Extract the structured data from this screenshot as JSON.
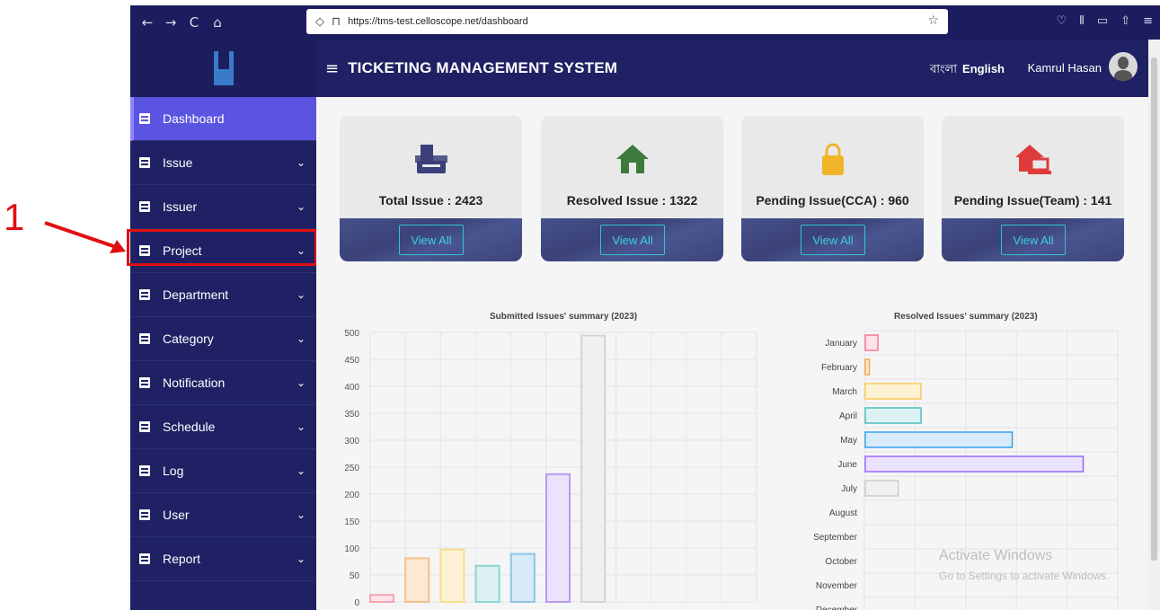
{
  "browser": {
    "url": "https://tms-test.celloscope.net/dashboard",
    "nav": [
      "←",
      "→",
      "C",
      "⌂"
    ]
  },
  "annotation": {
    "number": "1"
  },
  "header": {
    "title": "TICKETING MANAGEMENT SYSTEM",
    "lang_bn": "বাংলা",
    "lang_en": "English",
    "user": "Kamrul Hasan"
  },
  "sidebar": {
    "items": [
      {
        "label": "Dashboard",
        "icon": "dashboard-icon"
      },
      {
        "label": "Issue",
        "icon": "list-icon"
      },
      {
        "label": "Issuer",
        "icon": "list-icon"
      },
      {
        "label": "Project",
        "icon": "list-icon"
      },
      {
        "label": "Department",
        "icon": "list-icon"
      },
      {
        "label": "Category",
        "icon": "list-icon"
      },
      {
        "label": "Notification",
        "icon": "list-icon"
      },
      {
        "label": "Schedule",
        "icon": "list-icon"
      },
      {
        "label": "Log",
        "icon": "list-icon"
      },
      {
        "label": "User",
        "icon": "list-icon"
      },
      {
        "label": "Report",
        "icon": "report-icon"
      }
    ]
  },
  "cards": [
    {
      "label": "Total Issue :  2423",
      "button": "View All",
      "icon": "inbox-icon",
      "color": "#3b3f7a"
    },
    {
      "label": "Resolved Issue :  1322",
      "button": "View All",
      "icon": "home-icon",
      "color": "#3d7a3d"
    },
    {
      "label": "Pending Issue(CCA) :  960",
      "button": "View All",
      "icon": "lock-icon",
      "color": "#f0b429"
    },
    {
      "label": "Pending Issue(Team) :  141",
      "button": "View All",
      "icon": "house-laptop-icon",
      "color": "#e03b3b"
    }
  ],
  "chart_data": [
    {
      "type": "bar",
      "title": "Submitted Issues' summary (2023)",
      "ylim": [
        0,
        500
      ],
      "yticks": [
        "500",
        "450",
        "400",
        "350",
        "300",
        "250",
        "200",
        "150",
        "100",
        "50",
        "0"
      ],
      "values": [
        13,
        81,
        97,
        67,
        89,
        237,
        494,
        0,
        0,
        0,
        0,
        0
      ],
      "colors": [
        "#f4a3b4",
        "#f6c08a",
        "#f8dc8a",
        "#8fd3d3",
        "#8cc4e8",
        "#b79cf0",
        "#d4d4d4"
      ],
      "fills": [
        "#fde3e8",
        "#fde8d4",
        "#fdf2d4",
        "#dcf2f2",
        "#d8ebf8",
        "#ebe2fd",
        "#f0f0f0"
      ]
    },
    {
      "type": "bar",
      "orientation": "horizontal",
      "title": "Resolved Issues' summary (2023)",
      "categories": [
        "January",
        "February",
        "March",
        "April",
        "May",
        "June",
        "July",
        "August",
        "September",
        "October",
        "November",
        "December"
      ],
      "values": [
        25,
        8,
        110,
        110,
        290,
        430,
        65,
        0,
        0,
        0,
        0,
        0
      ],
      "colors": [
        "#f07a93",
        "#f6a54a",
        "#f8cc5a",
        "#4fc0bf",
        "#36a2eb",
        "#9966ff",
        "#c9cbcf"
      ],
      "fills": [
        "#fde3e8",
        "#fde8d4",
        "#fdf2d4",
        "#dcf2f2",
        "#d8ebf8",
        "#ebe2fd",
        "#f0f0f0"
      ]
    }
  ],
  "watermark": {
    "line1": "Activate Windows",
    "line2": "Go to Settings to activate Windows."
  }
}
